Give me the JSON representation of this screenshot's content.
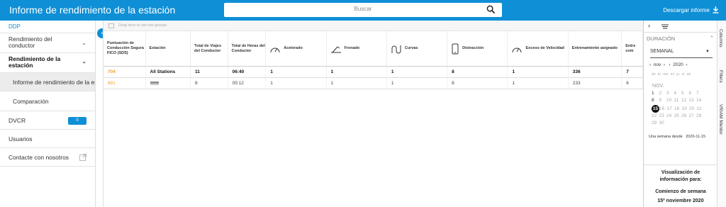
{
  "header": {
    "title": "Informe de rendimiento de la estación",
    "search_placeholder": "Buscar",
    "download_label": "Descargar informe"
  },
  "sidebar": {
    "brand": "DDP",
    "items": [
      {
        "label": "Rendimiento del conductor"
      },
      {
        "label": "Rendimiento de la estación"
      },
      {
        "label": "Informe de rendimiento de la estación"
      },
      {
        "label": "Comparación"
      },
      {
        "label": "DVCR",
        "badge": "0"
      },
      {
        "label": "Usuarios"
      },
      {
        "label": "Contacte con nosotros"
      }
    ]
  },
  "grid": {
    "drag_hint": "Drag here to set row groups",
    "columns": [
      {
        "label": "Puntuación de Conducción Segura FICO (SDS)",
        "icon": ""
      },
      {
        "label": "Estación",
        "icon": ""
      },
      {
        "label": "Total de Viajes del Conductor",
        "icon": ""
      },
      {
        "label": "Total de Horas del Conductor",
        "icon": ""
      },
      {
        "label": "Acelerado",
        "icon": "speedometer-icon"
      },
      {
        "label": "Frenado",
        "icon": "braking-icon"
      },
      {
        "label": "Curvas",
        "icon": "curve-icon"
      },
      {
        "label": "Distracción",
        "icon": "phone-icon"
      },
      {
        "label": "Exceso de Velocidad",
        "icon": "speedometer-icon"
      },
      {
        "label": "Entrenamiento asignado",
        "icon": ""
      },
      {
        "label": "Entre com",
        "icon": ""
      }
    ],
    "rows": [
      {
        "score": "704",
        "station": "All Stations",
        "trips": "11",
        "hours": "06:40",
        "accel": "1",
        "brake": "1",
        "curves": "1",
        "distraction": "8",
        "speeding": "1",
        "training": "336",
        "extra": "7"
      },
      {
        "score": "681",
        "station": "",
        "trips": "8",
        "hours": "05:12",
        "accel": "1",
        "brake": "1",
        "curves": "1",
        "distraction": "8",
        "speeding": "1",
        "training": "233",
        "extra": "6"
      }
    ]
  },
  "rightpanel": {
    "section": "DURACIÓN",
    "period": "SEMANAL",
    "month_nav": "nov",
    "year_nav": "2020",
    "dow": [
      "do",
      "lu",
      "ma",
      "mi",
      "ju",
      "vi",
      "sá"
    ],
    "month_label": "NOV.",
    "weeks": [
      [
        "1",
        "2",
        "3",
        "4",
        "5",
        "6",
        "7"
      ],
      [
        "8",
        "9",
        "10",
        "11",
        "12",
        "13",
        "14"
      ],
      [
        "15",
        "16",
        "17",
        "18",
        "19",
        "20",
        "21"
      ],
      [
        "22",
        "23",
        "24",
        "25",
        "26",
        "27",
        "28"
      ],
      [
        "29",
        "30"
      ]
    ],
    "selected_day": "15",
    "week_since_label": "Una semana desde",
    "week_since_value": "2020-11-15",
    "info_title": "Visualización de información para:",
    "info_week": "Comienzo de semana",
    "info_date": "15º noviembre 2020"
  },
  "vtabs": [
    "Columns",
    "Filters",
    "VRIAM Mentor"
  ],
  "colors": {
    "accent": "#0e8fd6",
    "score": "#f0a030"
  }
}
